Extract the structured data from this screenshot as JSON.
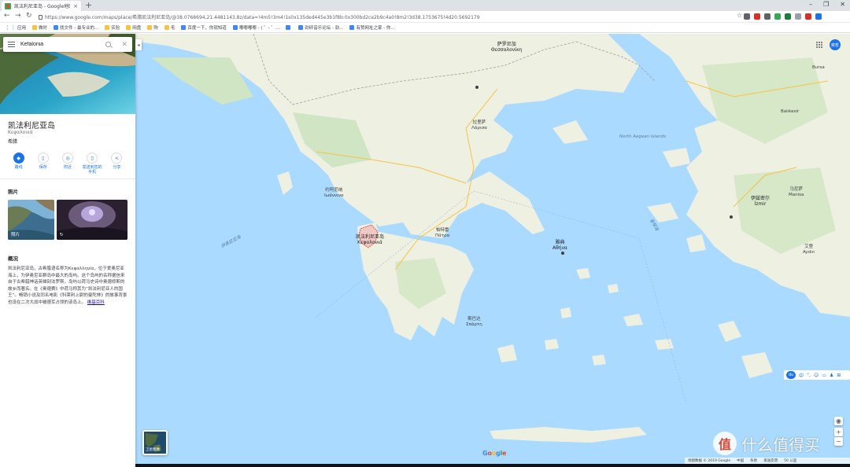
{
  "browser": {
    "tab_title": "凯法利尼亚岛 - Google地图",
    "tab_close": "×",
    "new_tab": "+",
    "window_controls": [
      "–",
      "❐",
      "✕"
    ],
    "nav": {
      "back": "←",
      "forward": "→",
      "reload": "↻"
    },
    "url": "https://www.google.com/maps/place/希腊凯法利尼亚岛/@38.0768694,21.4481143,8z/data=!4m5!3m4!1s0x135ded445e3b1f8b:0x300bd2ce2b9c4a0!8m2!3d38.1753675!4d20.5692179",
    "star": "☆",
    "extension_colors": [
      "#5f6368",
      "#d93025",
      "#5f6368",
      "#34a853",
      "#188038",
      "#9aa0a6",
      "#d93025",
      "#1a73e8"
    ]
  },
  "bookmarks": [
    {
      "label": "应用",
      "icon": "apps-grid-icon"
    },
    {
      "label": "做时",
      "icon": "folder-icon"
    },
    {
      "label": "找文件 - 最专业的...",
      "icon": "globe-icon"
    },
    {
      "label": "实验",
      "icon": "folder-icon"
    },
    {
      "label": "网盘",
      "icon": "folder-icon"
    },
    {
      "label": "购",
      "icon": "folder-icon"
    },
    {
      "label": "毛",
      "icon": "folder-icon"
    },
    {
      "label": "百度一下，你就知道",
      "icon": "baidu-icon"
    },
    {
      "label": "嘟嘟嘟嘟 - ( ゜- ゜...",
      "icon": "bilibili-icon"
    },
    {
      "label": "",
      "icon": "link-icon"
    },
    {
      "label": "劲砰音乐论坛 - 劲...",
      "icon": "music-icon"
    },
    {
      "label": "有赞网址之家 - 你...",
      "icon": "page-icon"
    }
  ],
  "panel": {
    "search_value": "Kefalonia",
    "title": "凯法利尼亚岛",
    "subtitle": "Κεφαλονιά",
    "type": "希腊",
    "collapse": "◂",
    "actions": [
      {
        "label": "路线",
        "icon": "directions-icon",
        "glyph": "◆"
      },
      {
        "label": "保存",
        "icon": "bookmark-icon",
        "glyph": "▯"
      },
      {
        "label": "附近",
        "icon": "nearby-icon",
        "glyph": "◎"
      },
      {
        "label": "发送到您的\n手机",
        "icon": "phone-icon",
        "glyph": "▯"
      },
      {
        "label": "分享",
        "icon": "share-icon",
        "glyph": "<"
      }
    ],
    "photos_title": "照片",
    "photo_label": "照片",
    "overview_title": "概况",
    "overview_text": "凯法利尼亚岛，古希腊语名称为Κεφαλληνία，位于爱奥尼亚海上，为伊奥尼亚群岛中最大的岛屿。这个岛屿的名称据信来自于古希腊神话英雄刻法罗斯，岛屿以荷马史诗中奥德修斯的故乡而著名。在《奥德赛》中荷马称其为“凯法利尼亚人的国王”。畅销小说及同名电影《科莱利上尉的曼陀林》的故事背景也设在二次大战中被德军占领的该岛上。",
    "wiki_link": "维基百科"
  },
  "map": {
    "avatar": "奕哲",
    "satellite_label": "卫星图像",
    "zoom_in": "+",
    "zoom_out": "−",
    "google_logo": [
      "G",
      "o",
      "o",
      "g",
      "l",
      "e"
    ],
    "google_colors": [
      "#4285f4",
      "#ea4335",
      "#fbbc05",
      "#4285f4",
      "#34a853",
      "#ea4335"
    ],
    "footer": [
      "地图数据 © 2019 Google",
      "中国",
      "条款",
      "发送反馈",
      "50 公里"
    ],
    "ime": {
      "du": "du",
      "items": [
        "中",
        "°,",
        "☺",
        "▭",
        "♟",
        "⊞"
      ]
    },
    "watermark": {
      "logo": "值",
      "text": "什么值得买"
    },
    "labels": {
      "thessaloniki": "萨罗尼加\nΘεσσαλονίκη",
      "ionian_sea": "伊奥尼亚海",
      "athens": "雅典\nΑθήνα",
      "izmir": "伊兹密尔\nİzmir",
      "north_aegean": "North Aegean Islands",
      "aegean": "爱琴海",
      "kefalonia": "凯法利尼亚岛\nΚεφαλονιά",
      "ioannina": "约阿尼纳\nΙωάννινα",
      "patras": "帕特雷\nΠάτρα",
      "larissa": "拉里萨\nΛάρισα",
      "bursa": "Bursa",
      "balikesir": "Balıkesir",
      "manisa": "马尼萨\nManisa",
      "aydin": "艾登\nAydın",
      "sparti": "斯巴达\nΣπάρτη"
    }
  }
}
